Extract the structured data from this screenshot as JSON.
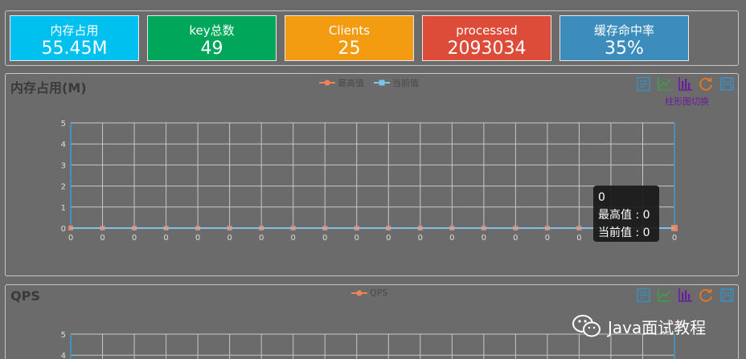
{
  "stats": [
    {
      "label": "内存占用",
      "value": "55.45M",
      "color": "#00c0ef"
    },
    {
      "label": "key总数",
      "value": "49",
      "color": "#00a65a"
    },
    {
      "label": "Clients",
      "value": "25",
      "color": "#f39c12"
    },
    {
      "label": "processed",
      "value": "2093034",
      "color": "#dd4b39"
    },
    {
      "label": "缓存命中率",
      "value": "35%",
      "color": "#3c8dbc"
    }
  ],
  "memory_panel": {
    "title": "内存占用(M)",
    "legend": [
      "最高值",
      "当前值"
    ],
    "tool_hint": "柱形图切换",
    "tooltip": {
      "header": "0",
      "line1": "最高值 : 0",
      "line2": "当前值 : 0"
    }
  },
  "qps_panel": {
    "title": "QPS",
    "legend": [
      "QPS"
    ]
  },
  "toolbox_icons": [
    "data-view-icon",
    "line-chart-icon",
    "bar-chart-icon",
    "restore-icon",
    "save-image-icon"
  ],
  "watermark": "Java面试教程",
  "colors": {
    "max_series": "#f2825a",
    "current_series": "#7ac4ea",
    "axis": "#3c9bd6",
    "grid": "#c8c8c8"
  },
  "chart_data": [
    {
      "type": "line",
      "x": [
        "0",
        "0",
        "0",
        "0",
        "0",
        "0",
        "0",
        "0",
        "0",
        "0",
        "0",
        "0",
        "0",
        "0",
        "0",
        "0",
        "0",
        "0",
        "0",
        "0"
      ],
      "series": [
        {
          "name": "最高值",
          "values": [
            0,
            0,
            0,
            0,
            0,
            0,
            0,
            0,
            0,
            0,
            0,
            0,
            0,
            0,
            0,
            0,
            0,
            0,
            0,
            0
          ]
        },
        {
          "name": "当前值",
          "values": [
            0,
            0,
            0,
            0,
            0,
            0,
            0,
            0,
            0,
            0,
            0,
            0,
            0,
            0,
            0,
            0,
            0,
            0,
            0,
            0
          ]
        }
      ],
      "yticks": [
        "0",
        "1",
        "2",
        "3",
        "4",
        "5"
      ],
      "ylim": [
        0,
        5
      ],
      "grid": true,
      "legend": "top-center"
    },
    {
      "type": "line",
      "x": [],
      "series": [
        {
          "name": "QPS",
          "values": []
        }
      ],
      "yticks": [
        "4",
        "5"
      ],
      "ylim": [
        0,
        5
      ],
      "grid": true,
      "legend": "top-center"
    }
  ]
}
